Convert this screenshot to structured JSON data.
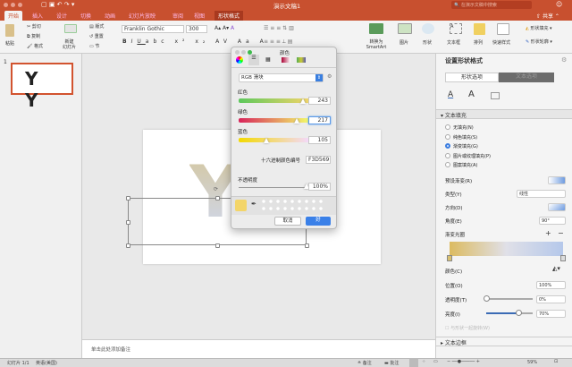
{
  "window": {
    "title": "演示文稿1",
    "search_placeholder": "在演示文稿中搜索",
    "share": "共享"
  },
  "tabs": [
    "开始",
    "插入",
    "设计",
    "切换",
    "动画",
    "幻灯片放映",
    "审阅",
    "视图",
    "形状格式"
  ],
  "ribbon": {
    "paste": "粘贴",
    "cut": "剪切",
    "copy": "复制",
    "format": "格式",
    "new_slide": "新建\n幻灯片",
    "layout": "版式",
    "reset": "重置",
    "section": "节",
    "font_name": "Franklin Gothic",
    "font_size": "300",
    "convert_smartart": "转换为 SmartArt",
    "picture": "图片",
    "shape": "形状",
    "textbox": "文本框",
    "arrange": "排列",
    "quick_styles": "快速样式",
    "shape_fill": "形状填充",
    "shape_outline": "形状轮廓"
  },
  "thumbnails": [
    {
      "number": "1",
      "text": "Y Y"
    }
  ],
  "slide": {
    "letter": "Y"
  },
  "notes_placeholder": "单击此处添加备注",
  "color_dialog": {
    "title": "颜色",
    "mode": "RGB 滑块",
    "red_label": "红色",
    "red": "243",
    "green_label": "绿色",
    "green": "217",
    "blue_label": "蓝色",
    "blue": "105",
    "hex_label": "十六进制颜色编号",
    "hex": "F3D569",
    "opacity_label": "不透明度",
    "opacity": "100%",
    "cancel": "取消",
    "ok": "好",
    "current_color": "#F3D569",
    "red_frac": 0.95,
    "green_frac": 0.85,
    "blue_frac": 0.41,
    "opacity_frac": 1.0
  },
  "panel": {
    "title": "设置形状格式",
    "tab_shape": "形状选项",
    "tab_text": "文本选项",
    "section_fill": "文本填充",
    "fill_options": [
      "无填充(N)",
      "纯色填充(S)",
      "渐变填充(G)",
      "图片或纹理填充(P)",
      "图案填充(A)"
    ],
    "fill_selected": 2,
    "preset": "预设渐变(R)",
    "type_label": "类型(Y)",
    "type_value": "线性",
    "direction": "方向(D)",
    "angle_label": "角度(E)",
    "angle_value": "90°",
    "stops_label": "渐变光圈",
    "color_label": "颜色(C)",
    "position_label": "位置(O)",
    "position_value": "100%",
    "transparency_label": "透明度(T)",
    "transparency_value": "0%",
    "brightness_label": "亮度(I)",
    "brightness_value": "70%",
    "brightness_frac": 0.7,
    "rotate_with_shape": "与形状一起旋转(W)",
    "section_outline": "文本边框"
  },
  "status": {
    "slide": "幻灯片 1/1",
    "language": "英语(美国)",
    "notes": "备注",
    "comments": "批注",
    "zoom": "59%"
  }
}
